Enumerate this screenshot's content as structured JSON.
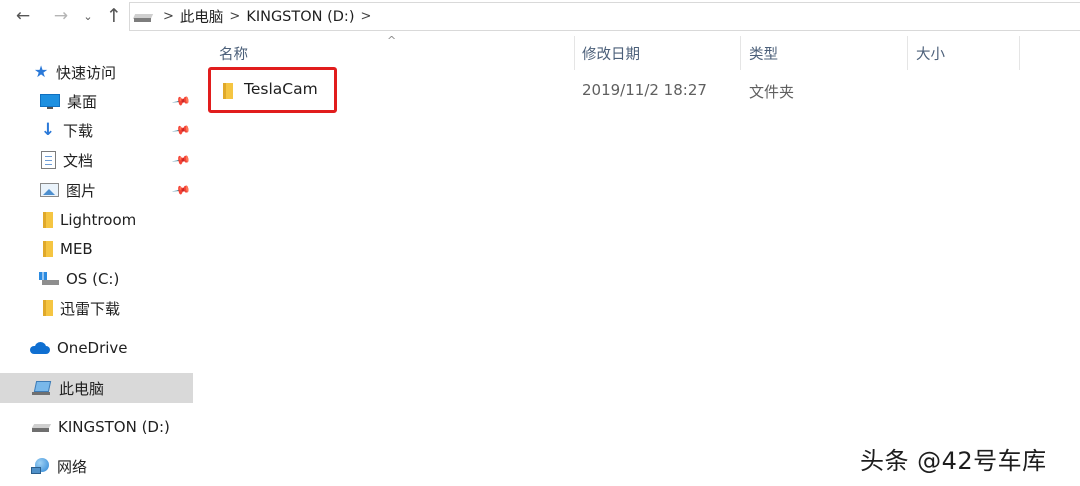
{
  "toolbar": {
    "back_icon": "arrow-left-icon",
    "forward_icon": "arrow-right-icon",
    "recent_icon": "chevron-down-icon",
    "up_icon": "arrow-up-icon",
    "back_glyph": "←",
    "forward_glyph": "→",
    "recent_glyph": "⌄",
    "up_glyph": "↑"
  },
  "breadcrumb": {
    "separator": ">",
    "items": [
      "此电脑",
      "KINGSTON (D:)"
    ]
  },
  "sidebar": {
    "pin_glyph": "📌",
    "items": [
      {
        "label": "快速访问",
        "icon": "star-icon",
        "pinned": false
      },
      {
        "label": "桌面",
        "icon": "desktop-icon",
        "pinned": true
      },
      {
        "label": "下载",
        "icon": "download-icon",
        "pinned": true
      },
      {
        "label": "文档",
        "icon": "document-icon",
        "pinned": true
      },
      {
        "label": "图片",
        "icon": "picture-icon",
        "pinned": true
      },
      {
        "label": "Lightroom",
        "icon": "folder-icon",
        "pinned": false
      },
      {
        "label": "MEB",
        "icon": "folder-icon",
        "pinned": false
      },
      {
        "label": "OS (C:)",
        "icon": "os-drive-icon",
        "pinned": false
      },
      {
        "label": "迅雷下载",
        "icon": "folder-icon",
        "pinned": false
      },
      {
        "label": "OneDrive",
        "icon": "cloud-icon",
        "pinned": false
      },
      {
        "label": "此电脑",
        "icon": "computer-icon",
        "pinned": false,
        "selected": true
      },
      {
        "label": "KINGSTON (D:)",
        "icon": "usb-drive-icon",
        "pinned": false
      },
      {
        "label": "网络",
        "icon": "network-icon",
        "pinned": false
      }
    ]
  },
  "columns": {
    "name": "名称",
    "modified": "修改日期",
    "type": "类型",
    "size": "大小",
    "sort_glyph": "^"
  },
  "files": [
    {
      "name": "TeslaCam",
      "modified": "2019/11/2 18:27",
      "type": "文件夹",
      "icon": "folder-icon"
    }
  ],
  "colors": {
    "highlight_border": "#e11d1d",
    "selected_background": "#d9d9d9",
    "header_text": "#4c607a"
  },
  "watermark": "头条 @42号车库"
}
